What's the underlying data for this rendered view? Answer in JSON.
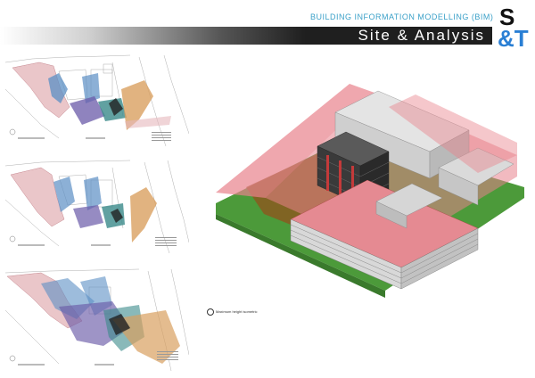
{
  "header": {
    "subtitle": "BUILDING INFORMATION MODELLING (BIM)",
    "title": "Site & Analysis"
  },
  "logo": {
    "line1": "S",
    "line2": "&T",
    "colors": {
      "line1": "#111111",
      "line2": "#2a7fd4"
    }
  },
  "main": {
    "iso_caption": "Maximum height isometric"
  },
  "colors": {
    "accent_blue": "#3aa0c8",
    "roof_red": "#e8828c",
    "shadow_brown": "#8a5a20",
    "grass_green": "#4c9a3a",
    "overlay_blue": "#5b8fc4",
    "overlay_purple": "#6a5aa8",
    "overlay_teal": "#3a8a8a",
    "overlay_orange": "#d9a060"
  }
}
